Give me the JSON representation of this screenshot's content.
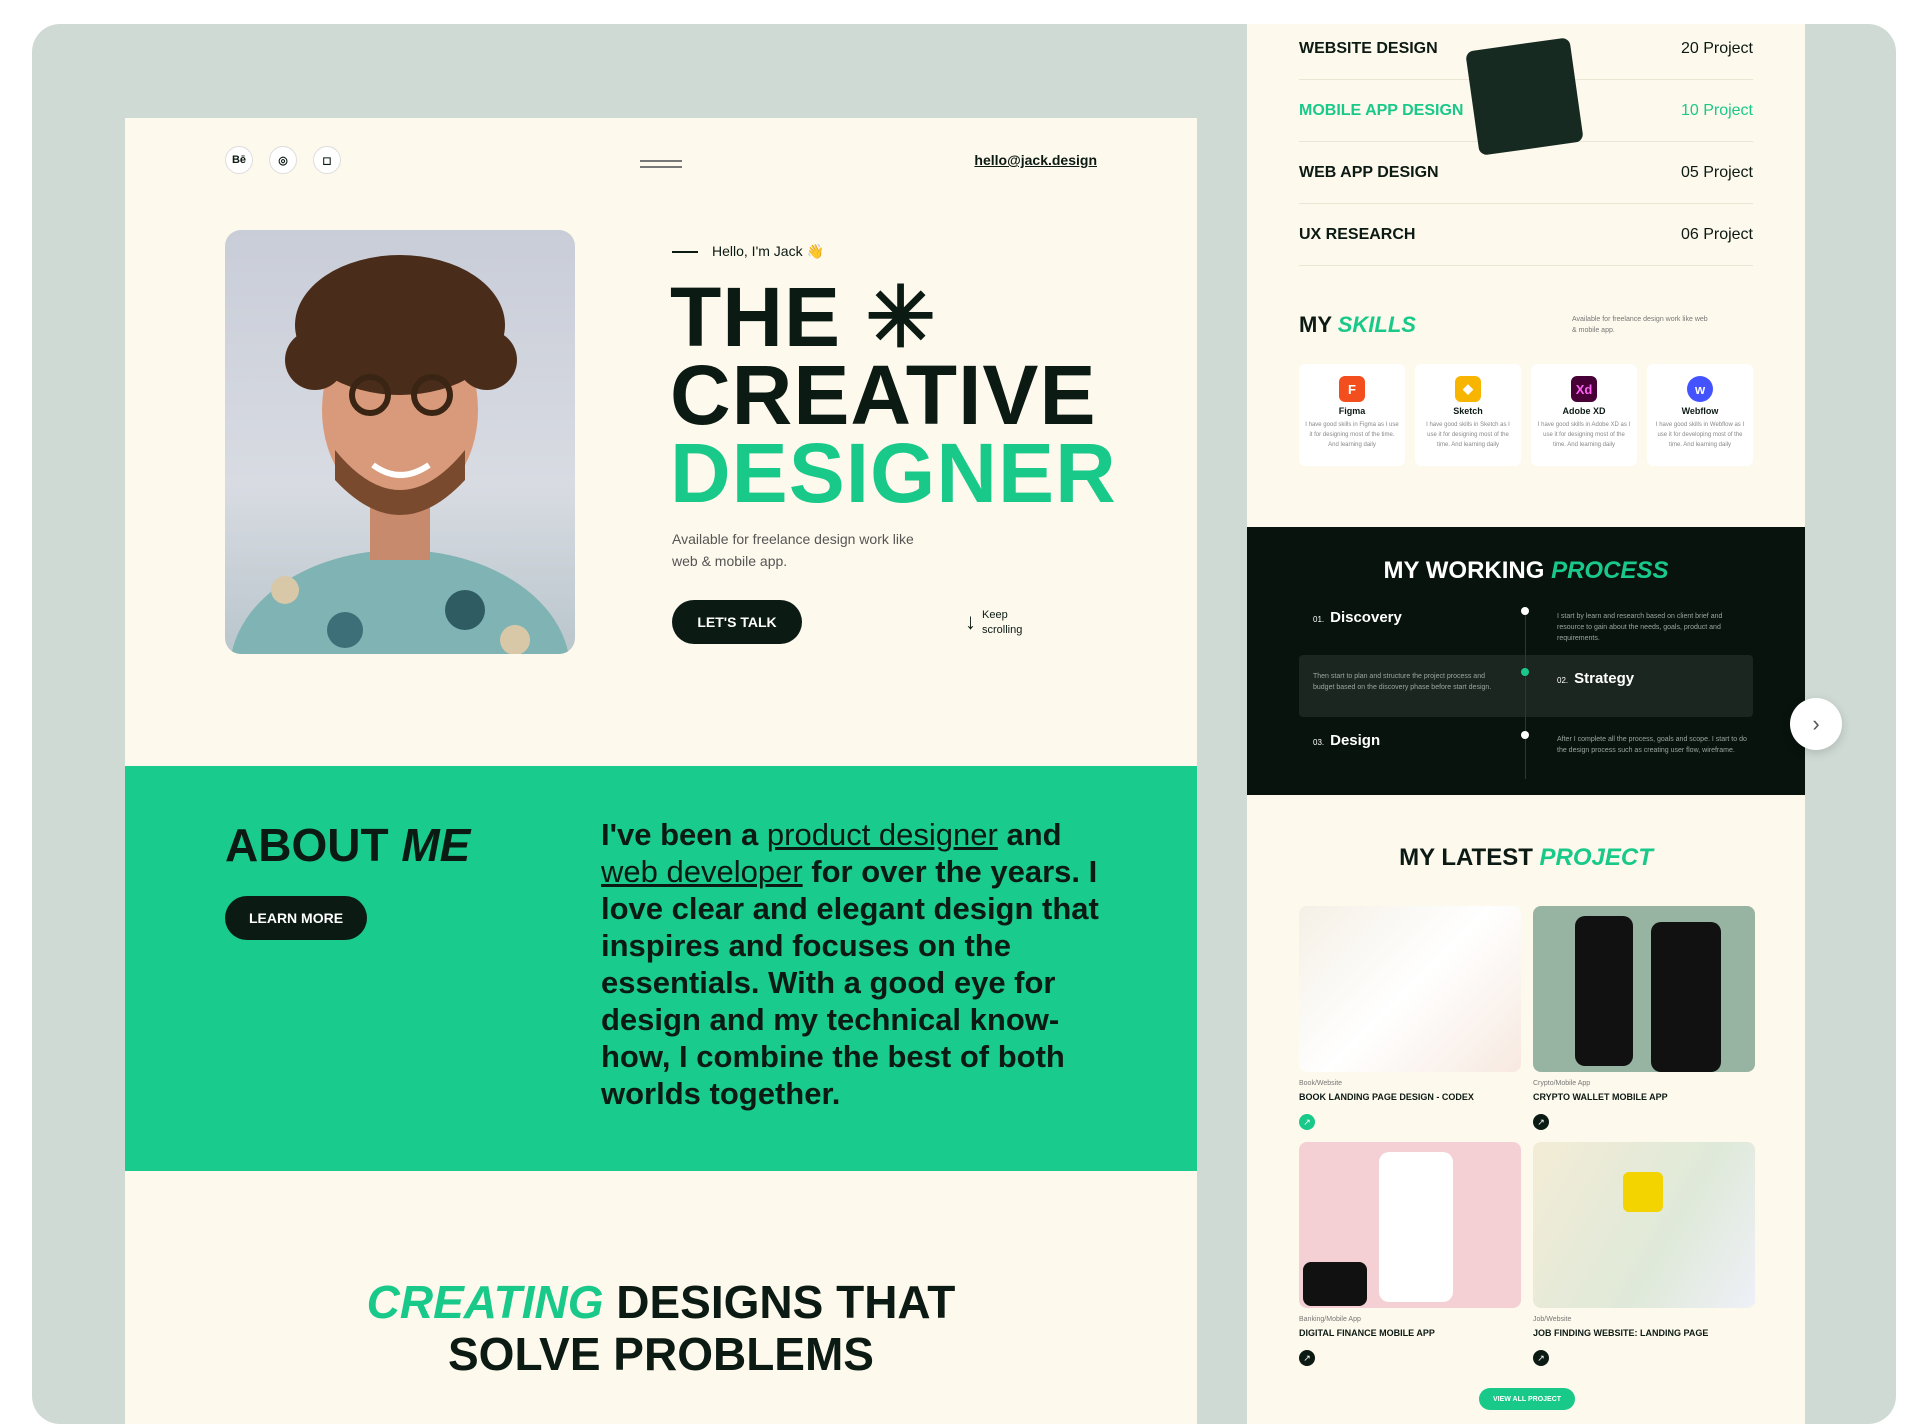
{
  "colors": {
    "accent": "#19cb8c",
    "dark": "#0c1a14",
    "cream": "#fdf9ec",
    "bg": "#cfdad4"
  },
  "left": {
    "social": [
      "Bē",
      "◎",
      "◻"
    ],
    "email": "hello@jack.design",
    "hello": "Hello, I'm Jack 👋",
    "headline": {
      "line1": "THE ✳",
      "line2": "CREATIVE",
      "line3": "DESIGNER"
    },
    "sub": "Available for freelance design work like web & mobile app.",
    "talk": "LET'S TALK",
    "scroll": {
      "l1": "Keep",
      "l2": "scrolling"
    },
    "about": {
      "title_a": "ABOUT ",
      "title_b": "ME",
      "learn": "LEARN MORE",
      "t1": "I've been a ",
      "link1": "product designer",
      "t2": " and ",
      "link2": "web developer",
      "t3": " for over the years. I love clear and elegant design that inspires and focuses on the essentials. With a good eye for design and my technical know-how, I combine the best of both worlds together."
    },
    "creating": {
      "a": "CREATING",
      "b": " DESIGNS THAT",
      "c": "SOLVE PROBLEMS"
    }
  },
  "right": {
    "services": [
      {
        "name": "WEBSITE DESIGN",
        "count": "20 Project"
      },
      {
        "name": "MOBILE APP DESIGN",
        "count": "10 Project"
      },
      {
        "name": "WEB APP DESIGN",
        "count": "05 Project"
      },
      {
        "name": "UX RESEARCH",
        "count": "06 Project"
      }
    ],
    "skills": {
      "title_a": "MY ",
      "title_b": "SKILLS",
      "sub": "Available for freelance design work like web & mobile app.",
      "items": [
        {
          "name": "Figma",
          "desc": "I have good skills in Figma as I use it for designing most of the time. And learning daily"
        },
        {
          "name": "Sketch",
          "desc": "I have good skills in Sketch as I use it for designing most of the time. And learning daily"
        },
        {
          "name": "Adobe XD",
          "desc": "I have good skills in Adobe XD as I use it for designing most of the time. And learning daily"
        },
        {
          "name": "Webflow",
          "desc": "I have good skills in Webflow as I use it for developing most of the time. And learning daily"
        }
      ]
    },
    "process": {
      "title_a": "MY WORKING ",
      "title_b": "PROCESS",
      "steps": [
        {
          "num": "01.",
          "name": "Discovery",
          "desc": "I start by learn and research based on client brief and resource to gain about the needs, goals, product and requirements."
        },
        {
          "num": "02.",
          "name": "Strategy",
          "desc": "Then start to plan and structure the project process and budget based on the discovery phase before start design."
        },
        {
          "num": "03.",
          "name": "Design",
          "desc": "After I complete all the process, goals and scope. I start to do the design process such as creating user flow, wireframe."
        }
      ]
    },
    "latest": {
      "title_a": "MY LATEST ",
      "title_b": "PROJECT",
      "projects": [
        {
          "cat": "Book/Website",
          "title": "BOOK LANDING PAGE DESIGN - CODEX"
        },
        {
          "cat": "Crypto/Mobile App",
          "title": "CRYPTO WALLET MOBILE APP"
        },
        {
          "cat": "Banking/Mobile App",
          "title": "DIGITAL FINANCE MOBILE APP"
        },
        {
          "cat": "Job/Website",
          "title": "JOB FINDING WEBSITE: LANDING PAGE"
        }
      ],
      "view_all": "VIEW ALL PROJECT"
    }
  }
}
